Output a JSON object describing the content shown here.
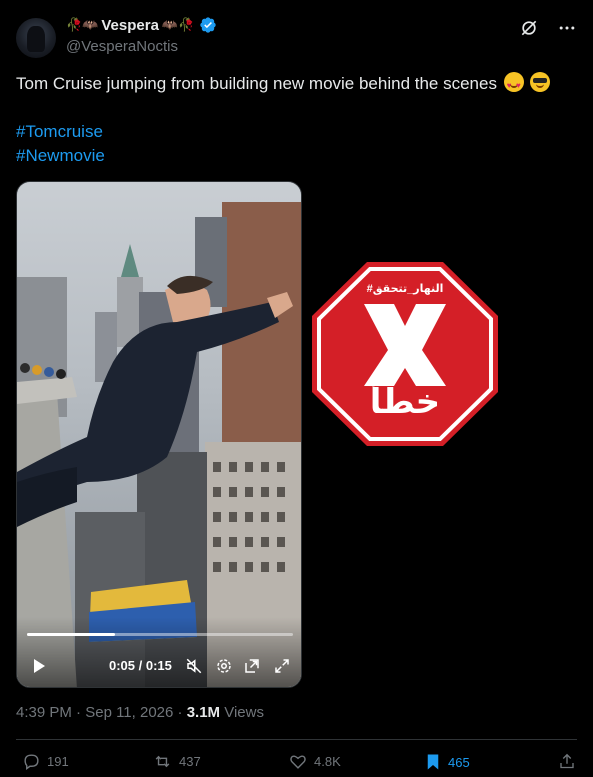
{
  "author": {
    "display_name": "Vespera",
    "handle": "@VesperaNoctis",
    "left_decoration": "🥀🦇",
    "right_decoration": "🦇🥀",
    "verified": true
  },
  "tweet": {
    "text": "Tom Cruise jumping from building new movie behind the scenes",
    "emojis": [
      "heart-eyes-emoji",
      "sunglasses-emoji"
    ],
    "hashtags": [
      "#Tomcruise",
      "#Newmovie"
    ]
  },
  "video": {
    "time_display": "0:05 / 0:15",
    "progress_fraction": 0.33
  },
  "overlay_badge": {
    "top_text": "#النهار_تتحقق",
    "center_mark": "X",
    "bottom_text": "خطأ",
    "color": "#d41f27"
  },
  "meta": {
    "time": "4:39 PM",
    "separator": "·",
    "date": "Sep 11, 2026",
    "views_count": "3.1M",
    "views_label": "Views"
  },
  "actions": {
    "replies": "191",
    "reposts": "437",
    "likes": "4.8K",
    "bookmarks": "465"
  },
  "colors": {
    "accent": "#1d9bf0",
    "muted": "#71767b",
    "text": "#e7e9ea",
    "background": "#000000"
  }
}
